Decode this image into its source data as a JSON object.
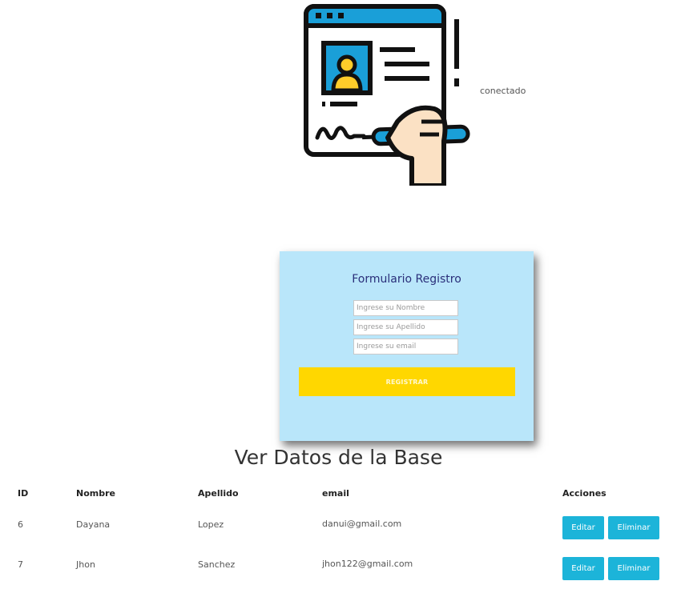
{
  "header": {
    "status": "conectado",
    "illustration": "signing-document-icon"
  },
  "form": {
    "title": "Formulario Registro",
    "fields": [
      {
        "name": "nombre",
        "placeholder": "Ingrese su Nombre",
        "value": ""
      },
      {
        "name": "apellido",
        "placeholder": "Ingrese su Apellido",
        "value": ""
      },
      {
        "name": "email",
        "placeholder": "Ingrese su email",
        "value": ""
      }
    ],
    "submit_label": "REGISTRAR"
  },
  "table": {
    "title": "Ver Datos de la Base",
    "columns": [
      "ID",
      "Nombre",
      "Apellido",
      "email",
      "Acciones"
    ],
    "rows": [
      {
        "id": "6",
        "nombre": "Dayana",
        "apellido": "Lopez",
        "email": "danui@gmail.com"
      },
      {
        "id": "7",
        "nombre": "Jhon",
        "apellido": "Sanchez",
        "email": "jhon122@gmail.com"
      }
    ],
    "edit_label": "Editar",
    "delete_label": "Eliminar"
  },
  "colors": {
    "card_bg": "#b9e6fa",
    "submit_bg": "#ffd700",
    "action_bg": "#1cb4d9",
    "form_title": "#2a2f7a"
  }
}
